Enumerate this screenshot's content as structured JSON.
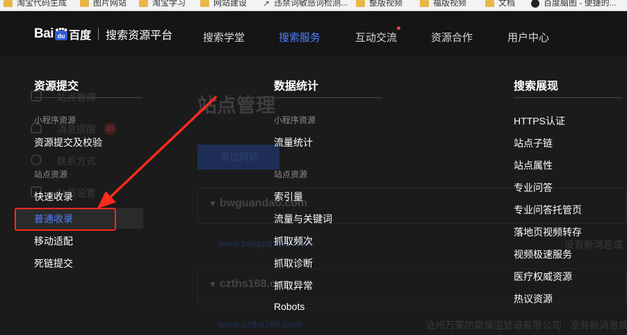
{
  "bookmarks": [
    {
      "label": "淘宝代码生成",
      "icon": "folder-icon"
    },
    {
      "label": "图片网站",
      "icon": "folder-icon"
    },
    {
      "label": "淘宝学习",
      "icon": "folder-icon"
    },
    {
      "label": "网站建设",
      "icon": "folder-icon"
    },
    {
      "label": "违禁词敏感词检测...",
      "icon": "page-icon"
    },
    {
      "label": "整版视频",
      "icon": "folder-icon"
    },
    {
      "label": "福版视频",
      "icon": "folder-icon"
    },
    {
      "label": "文档",
      "icon": "folder-icon"
    },
    {
      "label": "百度脑图 - 便捷的...",
      "icon": "baidu-mind-icon"
    }
  ],
  "header": {
    "logo_bai": "Bai",
    "logo_du": "百度",
    "platform_title": "搜索资源平台",
    "nav": [
      {
        "label": "搜索学堂",
        "active": false
      },
      {
        "label": "搜索服务",
        "active": true
      },
      {
        "label": "互动交流",
        "active": false,
        "dot": true
      },
      {
        "label": "资源合作",
        "active": false
      },
      {
        "label": "用户中心",
        "active": false
      }
    ]
  },
  "background_page": {
    "title": "站点管理",
    "add_button": "添加网站",
    "side_labels": [
      "站点管理",
      "消息提醒",
      "联系方式",
      "站员设置"
    ],
    "badge": "25",
    "sites": [
      {
        "name": "bwguandao.com",
        "url": "www.bwguandao.com",
        "note": "没有新消息或"
      },
      {
        "name": "czths168.com",
        "url": "www.czths168.com",
        "company": "沧州万荣防腐保温管道有限公司",
        "note": "没有新消息或"
      }
    ]
  },
  "menu": {
    "columns": [
      {
        "title": "资源提交",
        "groups": [
          {
            "label": "小程序资源",
            "items": [
              "资源提交及校验"
            ]
          },
          {
            "label": "站点资源",
            "items": [
              "快速收录",
              "普通收录",
              "移动适配",
              "死链提交"
            ]
          }
        ]
      },
      {
        "title": "数据统计",
        "groups": [
          {
            "label": "小程序资源",
            "items": [
              "流量统计"
            ]
          },
          {
            "label": "站点资源",
            "items": [
              "索引量",
              "流量与关键词",
              "抓取频次",
              "抓取诊断",
              "抓取异常",
              "Robots"
            ]
          }
        ]
      },
      {
        "title": "搜索展现",
        "groups": [
          {
            "label": "",
            "items": [
              "HTTPS认证",
              "站点子链",
              "站点属性",
              "专业问答",
              "专业问答托管页",
              "落地页视频转存",
              "视频极速服务",
              "医疗权威资源",
              "热议资源"
            ]
          }
        ]
      }
    ],
    "highlighted_item": "普通收录"
  },
  "colors": {
    "accent": "#4e7fff",
    "annotation": "#ff2a1c",
    "nav_bg": "#151515",
    "menu_bg": "#1f1f1f"
  }
}
